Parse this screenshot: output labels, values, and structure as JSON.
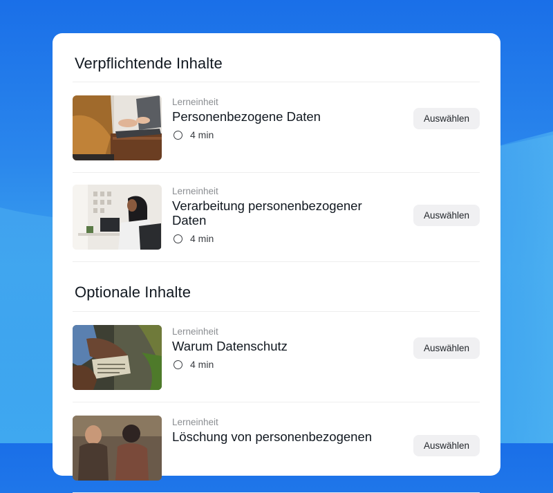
{
  "sections": [
    {
      "title": "Verpflichtende Inhalte",
      "items": [
        {
          "kicker": "Lerneinheit",
          "title": "Personenbezogene Daten",
          "duration": "4 min",
          "button": "Auswählen",
          "thumbnail": "laptop-typing"
        },
        {
          "kicker": "Lerneinheit",
          "title": "Verarbeitung personenbezogener Daten",
          "duration": "4 min",
          "button": "Auswählen",
          "thumbnail": "woman-at-desk"
        }
      ]
    },
    {
      "title": "Optionale Inhalte",
      "items": [
        {
          "kicker": "Lerneinheit",
          "title": "Warum Datenschutz",
          "duration": "4 min",
          "button": "Auswählen",
          "thumbnail": "clipboard-plant"
        },
        {
          "kicker": "Lerneinheit",
          "title": "Löschung von personenbezogenen",
          "duration": "",
          "button": "Auswählen",
          "thumbnail": "meeting-people"
        }
      ]
    }
  ],
  "colors": {
    "background_top": "#1a6fe8",
    "background_bottom": "#3fa8f0",
    "card": "#ffffff",
    "button_bg": "#f0f0f2",
    "text_primary": "#111820",
    "text_muted": "#8a8d91"
  }
}
